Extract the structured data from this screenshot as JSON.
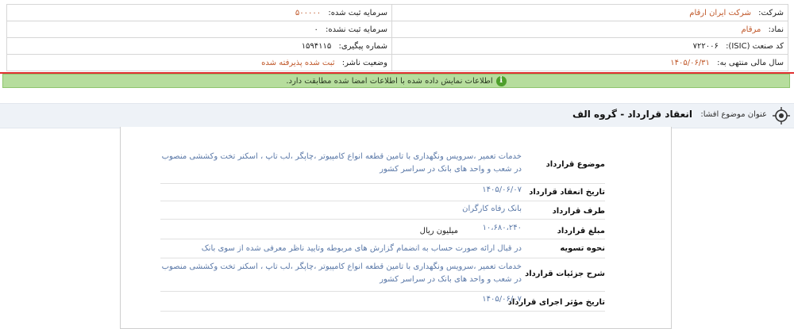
{
  "company_info": {
    "company_label": "شرکت:",
    "company_value": "شرکت ایران ارقام",
    "capital_registered_label": "سرمایه ثبت شده:",
    "capital_registered_value": "۵۰۰۰۰۰",
    "symbol_label": "نماد:",
    "symbol_value": "مرقام",
    "capital_unregistered_label": "سرمایه ثبت نشده:",
    "capital_unregistered_value": "۰",
    "isic_label": "کد صنعت (ISIC):",
    "isic_value": "۷۲۲۰۰۶",
    "tracking_label": "شماره پیگیری:",
    "tracking_value": "۱۵۹۴۱۱۵",
    "fiscal_year_label": "سال مالی منتهی به:",
    "fiscal_year_value": "۱۴۰۵/۰۶/۳۱",
    "publisher_status_label": "وضعیت ناشر:",
    "publisher_status_value": "ثبت شده پذیرفته شده"
  },
  "banner": {
    "icon": "info-icon",
    "message": "اطلاعات نمایش داده شده با اطلاعات امضا شده مطابقت دارد."
  },
  "subject": {
    "icon": "target-icon",
    "label": "عنوان موضوع افشا:",
    "title": "انعقاد قرارداد - گروه الف"
  },
  "contract": {
    "rows": [
      {
        "label": "موضوع قرارداد",
        "value": "خدمات تعمیر ،سرویس ونگهداری با تامین قطعه انواع کامپیوتر ،چاپگر ،لب تاپ ، اسکنر تخت وکششی منصوب در شعب و واحد های بانک در سراسر کشور"
      },
      {
        "label": "تاریخ انعقاد قرارداد",
        "value": "۱۴۰۵/۰۶/۰۷"
      },
      {
        "label": "طرف قرارداد",
        "value": "بانک رفاه کارگران"
      },
      {
        "label": "مبلغ قرارداد",
        "value": "۱۰،۶۸۰،۲۴۰",
        "unit": "میلیون ریال"
      },
      {
        "label": "نحوه تسویه",
        "value": "در قبال ارائه صورت حساب به انضمام گزارش های مربوطه وتایید ناظر معرفی شده از سوی بانک"
      },
      {
        "label": "شرح جزئیات قرارداد",
        "value": "خدمات تعمیر ،سرویس ونگهداری با تامین قطعه انواع کامپیوتر ،چاپگر ،لب تاپ ، اسکنر تخت وکششی منصوب در شعب و واحد های بانک در سراسر کشور"
      },
      {
        "label": "تاریخ مؤثر اجرای قرارداد",
        "value": "۱۴۰۵/۰۶/۰۷"
      }
    ]
  },
  "colors": {
    "value_orange": "#c0582a",
    "value_blue": "#5b79a8",
    "banner_green": "#b6dd9d",
    "divider_red": "#e03030"
  }
}
